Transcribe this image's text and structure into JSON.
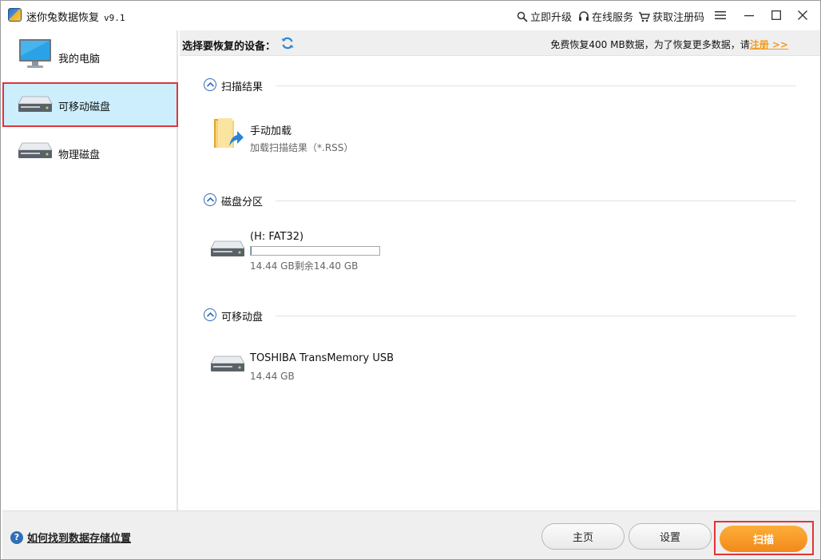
{
  "window": {
    "title": "迷你兔数据恢复",
    "version": "v9.1",
    "links": {
      "upgrade": "立即升级",
      "online_service": "在线服务",
      "get_code": "获取注册码"
    }
  },
  "sidebar": {
    "items": [
      {
        "label": "我的电脑",
        "icon": "monitor-icon"
      },
      {
        "label": "可移动磁盘",
        "icon": "removable-disk-icon"
      },
      {
        "label": "物理磁盘",
        "icon": "physical-disk-icon"
      }
    ],
    "selected_index": 1
  },
  "device_bar": {
    "label": "选择要恢复的设备：",
    "free_message": "免费恢复400 MB数据，为了恢复更多数据，请",
    "register_link": "注册 >>"
  },
  "sections": {
    "scan_results": {
      "title": "扫描结果",
      "item": {
        "title": "手动加载",
        "subtitle": "加载扫描结果（*.RSS）"
      }
    },
    "partitions": {
      "title": "磁盘分区",
      "item": {
        "title": "(H: FAT32)",
        "subtitle": "14.44 GB剩余14.40 GB",
        "used_fraction": 0.003
      }
    },
    "removable": {
      "title": "可移动盘",
      "item": {
        "title": "TOSHIBA TransMemory USB",
        "subtitle": "14.44 GB"
      }
    }
  },
  "footer": {
    "help_text": "如何找到数据存储位置",
    "home_label": "主页",
    "settings_label": "设置",
    "scan_label": "扫描"
  },
  "colors": {
    "accent_blue": "#2c6bb8",
    "selected_bg": "#cdeefc",
    "highlight_red": "#e0343a",
    "scan_orange": "#f2891a",
    "register_orange": "#f39a1d"
  }
}
